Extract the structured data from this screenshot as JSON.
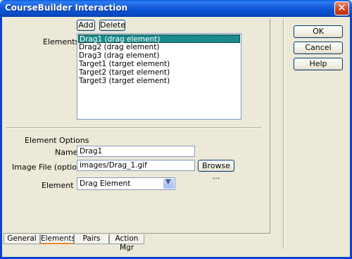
{
  "window": {
    "title": "CourseBuilder Interaction"
  },
  "toolbar": {
    "add_label": "Add",
    "delete_label": "Delete"
  },
  "elements": {
    "label": "Elements:",
    "items": [
      {
        "label": "Drag1 (drag element)",
        "selected": true
      },
      {
        "label": "Drag2 (drag element)",
        "selected": false
      },
      {
        "label": "Drag3 (drag element)",
        "selected": false
      },
      {
        "label": "Target1 (target element)",
        "selected": false
      },
      {
        "label": "Target2 (target element)",
        "selected": false
      },
      {
        "label": "Target3 (target element)",
        "selected": false
      }
    ]
  },
  "options": {
    "heading": "Element Options",
    "name_label": "Name:",
    "name_value": "Drag1",
    "image_label": "Image File (optional):",
    "image_value": "images/Drag_1.gif",
    "browse_label": "Browse ...",
    "element_is_label": "Element Is:",
    "element_is_value": "Drag Element"
  },
  "tabs": [
    {
      "label": "General",
      "active": false
    },
    {
      "label": "Elements",
      "active": true
    },
    {
      "label": "Pairs",
      "active": false
    },
    {
      "label": "Action Mgr",
      "active": false
    }
  ],
  "side_buttons": {
    "ok": "OK",
    "cancel": "Cancel",
    "help": "Help"
  },
  "colors": {
    "title_bar": "#0a5ddb",
    "selection": "#1a8a8a",
    "active_tab_accent": "#e68b2c"
  }
}
